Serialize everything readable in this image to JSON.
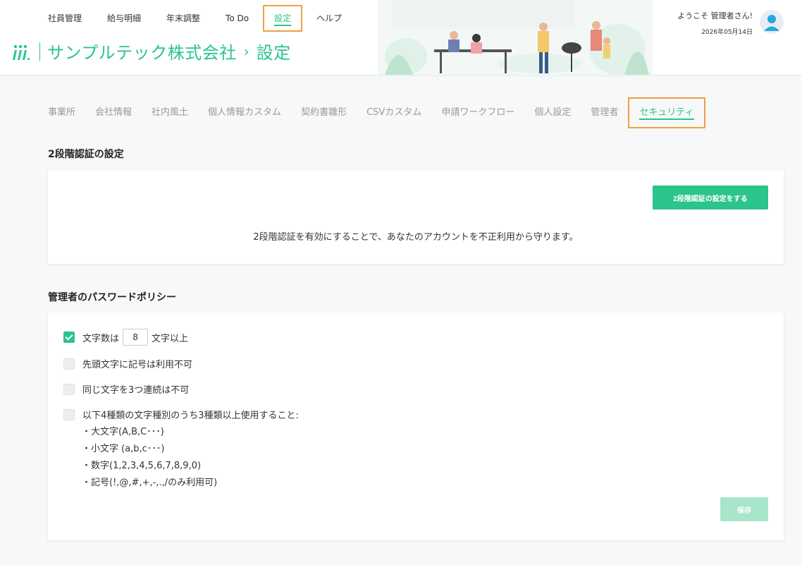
{
  "topnav": [
    "社員管理",
    "給与明細",
    "年末調整",
    "To Do",
    "設定",
    "ヘルプ"
  ],
  "brand": {
    "company": "サンプルテック株式会社",
    "separator": "›",
    "page": "設定"
  },
  "user": {
    "welcome": "ようこそ 管理者さん!",
    "date": "2026年05月14日"
  },
  "tabs": [
    "事業所",
    "会社情報",
    "社内風土",
    "個人情報カスタム",
    "契約書雛形",
    "CSVカスタム",
    "申請ワークフロー",
    "個人設定",
    "管理者",
    "セキュリティ"
  ],
  "two_factor": {
    "title": "2段階認証の設定",
    "button": "2段階認証の設定をする",
    "description": "2段階認証を有効にすることで、あなたのアカウントを不正利用から守ります。"
  },
  "password_policy": {
    "title": "管理者のパスワードポリシー",
    "min_length_prefix": "文字数は",
    "min_length_value": "8",
    "min_length_suffix": "文字以上",
    "opt2": "先頭文字に記号は利用不可",
    "opt3": "同じ文字を3つ連続は不可",
    "opt4": "以下4種類の文字種別のうち3種類以上使用すること:",
    "sub": [
      "・大文字(A,B,C･･･)",
      "・小文字 (a,b,c･･･)",
      "・数字(1,2,3,4,5,6,7,8,9,0)",
      "・記号(!,@,#,+,-,.,/のみ利用可)"
    ],
    "save": "保存"
  },
  "colors": {
    "accent": "#2bc48a",
    "highlight": "#f0a040"
  }
}
